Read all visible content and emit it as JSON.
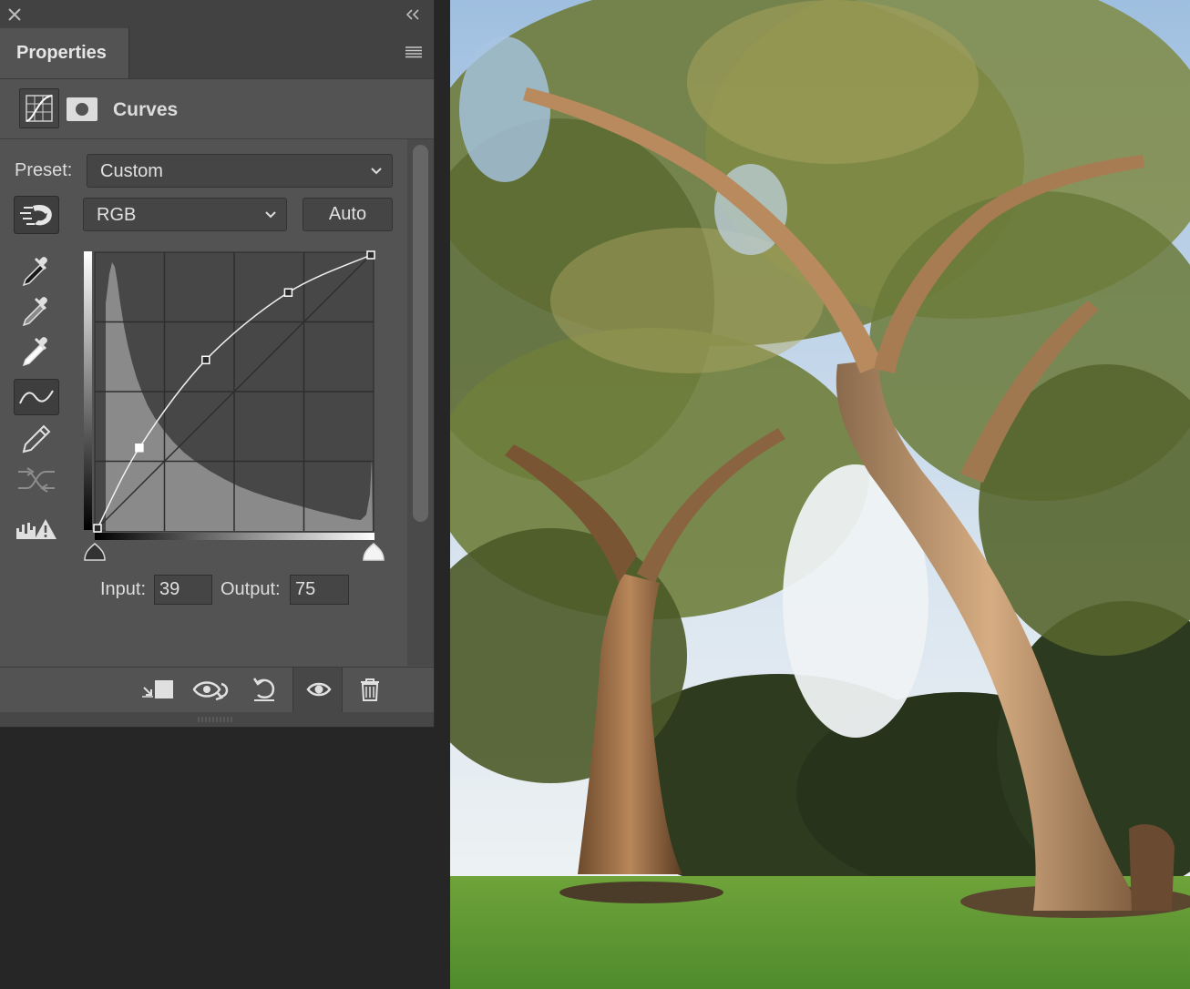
{
  "panel": {
    "tab_label": "Properties",
    "adjustment_title": "Curves",
    "preset_label": "Preset:",
    "preset_value": "Custom",
    "channel_value": "RGB",
    "auto_label": "Auto",
    "input_label": "Input:",
    "input_value": "39",
    "output_label": "Output:",
    "output_value": "75"
  },
  "curve": {
    "points": [
      [
        0,
        0
      ],
      [
        39,
        75
      ],
      [
        101,
        157
      ],
      [
        178,
        220
      ],
      [
        255,
        255
      ]
    ]
  },
  "icons": {
    "close": "close-icon",
    "collapse": "double-chevron-icon",
    "menu": "panel-menu-icon",
    "curves_adjustment": "curves-adjustment-icon",
    "mask": "layer-mask-icon",
    "target_adjust": "on-image-adjust-icon",
    "black_point": "black-eyedropper-icon",
    "gray_point": "gray-eyedropper-icon",
    "white_point": "white-eyedropper-icon",
    "edit_points": "curve-points-icon",
    "draw_pencil": "pencil-icon",
    "smooth": "smooth-curve-icon",
    "clipping": "clipping-warning-icon",
    "clip_to_layer": "clip-to-layer-icon",
    "view_previous": "view-previous-state-icon",
    "reset": "reset-icon",
    "visibility": "eye-icon",
    "delete": "trash-icon"
  },
  "colors": {
    "panel_bg": "#535353",
    "tab_bar_bg": "#424242",
    "field_bg": "#454545",
    "histogram": "#8a8a8a",
    "graph_bg": "#474747"
  },
  "canvas": {
    "subject": "park-trees-photo"
  }
}
